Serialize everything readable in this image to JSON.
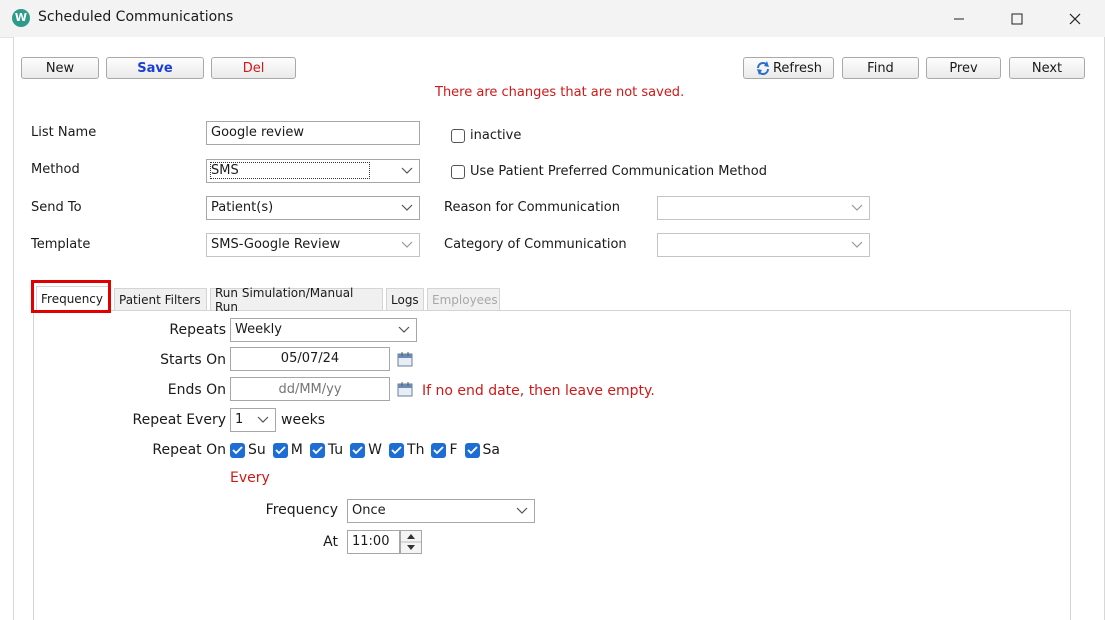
{
  "window": {
    "title": "Scheduled Communications",
    "icon_letter": "W"
  },
  "toolbar": {
    "new_label": "New",
    "save_label": "Save",
    "del_label": "Del",
    "refresh_label": "Refresh",
    "find_label": "Find",
    "prev_label": "Prev",
    "next_label": "Next"
  },
  "status": {
    "unsaved_message": "There are changes that are not saved."
  },
  "form": {
    "list_name_label": "List Name",
    "list_name_value": "Google review",
    "inactive_label": "inactive",
    "method_label": "Method",
    "method_value": "SMS",
    "use_preferred_label": "Use Patient Preferred Communication Method",
    "send_to_label": "Send To",
    "send_to_value": "Patient(s)",
    "reason_label": "Reason for Communication",
    "reason_value": "",
    "template_label": "Template",
    "template_value": "SMS-Google Review",
    "category_label": "Category of Communication",
    "category_value": ""
  },
  "tabs": [
    {
      "label": "Frequency",
      "active": true
    },
    {
      "label": "Patient Filters"
    },
    {
      "label": "Run Simulation/Manual Run"
    },
    {
      "label": "Logs"
    },
    {
      "label": "Employees",
      "disabled": true
    }
  ],
  "frequency": {
    "repeats_label": "Repeats",
    "repeats_value": "Weekly",
    "starts_on_label": "Starts On",
    "starts_on_value": "05/07/24",
    "ends_on_label": "Ends On",
    "ends_on_placeholder": "dd/MM/yy",
    "ends_on_hint": "If no end date, then leave empty.",
    "repeat_every_label": "Repeat Every",
    "repeat_every_value": "1",
    "repeat_every_unit": "weeks",
    "repeat_on_label": "Repeat On",
    "days": [
      "Su",
      "M",
      "Tu",
      "W",
      "Th",
      "F",
      "Sa"
    ],
    "every_label": "Every",
    "freq_label": "Frequency",
    "freq_value": "Once",
    "at_label": "At",
    "at_value": "11:00"
  },
  "colors": {
    "accent": "#1c6ed4",
    "warning": "#d01818",
    "highlight_box": "#e00000",
    "save_text": "#1a3fd4"
  }
}
